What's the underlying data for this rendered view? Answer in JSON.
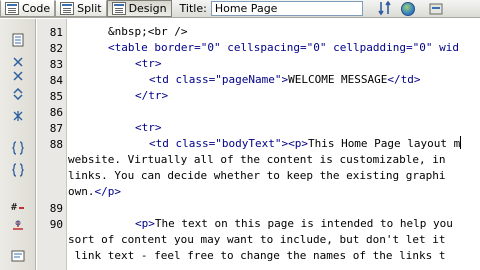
{
  "toolbar": {
    "code_label": "Code",
    "split_label": "Split",
    "design_label": "Design",
    "title_label": "Title:",
    "title_value": "Home Page"
  },
  "line_numbers": [
    "81",
    "82",
    "83",
    "84",
    "85",
    "86",
    "87",
    "88",
    "89",
    "90"
  ],
  "code": {
    "l81": "&nbsp;<br />",
    "l82": "<table border=\"0\" cellspacing=\"0\" cellpadding=\"0\" wid",
    "l83": "<tr>",
    "l84a": "<td class=\"pageName\">",
    "l84b": "WELCOME MESSAGE",
    "l84c": "</td>",
    "l85": "</tr>",
    "l87": "<tr>",
    "l88a": "<td class=\"bodyText\"><p>",
    "l88b": "This Home Page layout m",
    "l88w1": "website. Virtually all of the content is customizable, in",
    "l88w2": "links. You can decide whether to keep the existing graphi",
    "l88w3a": "own.",
    "l88w3b": "</p>",
    "l90a": "<p>",
    "l90b": "The text on this page is intended to help you",
    "l90w1": "sort of content you may want to include, but don't let it",
    "l90w2": " link text - feel free to change the names of the links t"
  },
  "colors": {
    "tag": "#000088",
    "text": "#000000",
    "gutter": "#e9e8e4"
  },
  "icons": {
    "toolbar": [
      "code-view-icon",
      "split-view-icon",
      "design-view-icon",
      "validate-icon",
      "browser-preview-icon",
      "refresh-icon"
    ],
    "gutter": [
      "open-documents-icon",
      "collapse-tag-icon",
      "collapse-selection-icon",
      "expand-all-icon",
      "select-parent-tag-icon",
      "balance-braces-icon",
      "line-numbers-icon",
      "highlight-invalid-icon",
      "apply-comment-icon",
      "format-source-icon"
    ]
  }
}
